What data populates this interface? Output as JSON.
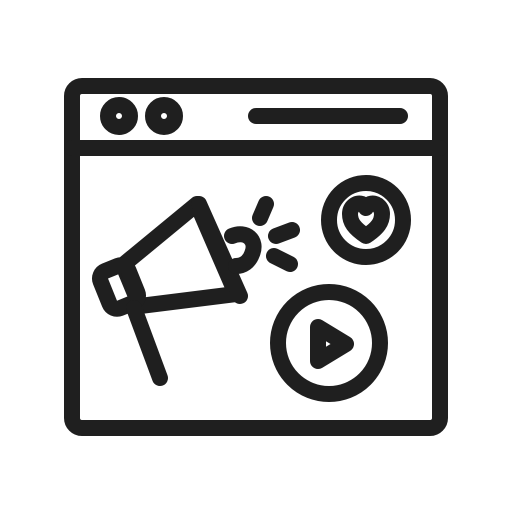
{
  "icon": {
    "name": "digital-marketing-browser-icon",
    "stroke_color": "#1f1f1f",
    "background_color": "#ffffff",
    "parts": [
      "browser-window-icon",
      "megaphone-icon",
      "heart-badge-icon",
      "play-button-icon"
    ]
  }
}
